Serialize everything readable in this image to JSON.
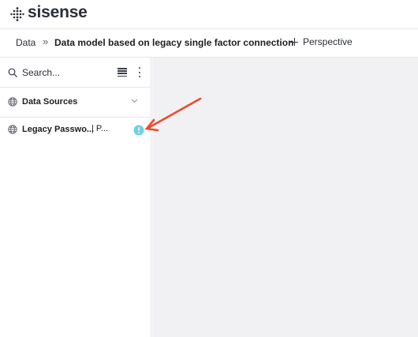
{
  "app": {
    "brand": "sisense"
  },
  "breadcrumb": {
    "root": "Data",
    "separator": "»",
    "current": "Data model based on legacy single factor connection"
  },
  "toolbar": {
    "perspective_label": "Perspective"
  },
  "sidebar": {
    "search": {
      "placeholder": "Search...",
      "value": ""
    },
    "data_sources": {
      "label": "Data Sources"
    },
    "connection": {
      "name": "Legacy Passwo...",
      "suffix": "| P..."
    }
  },
  "colors": {
    "info_badge": "#6ed3e0",
    "annotation_arrow": "#ee4a2c",
    "canvas_background": "#f1f1f4"
  }
}
